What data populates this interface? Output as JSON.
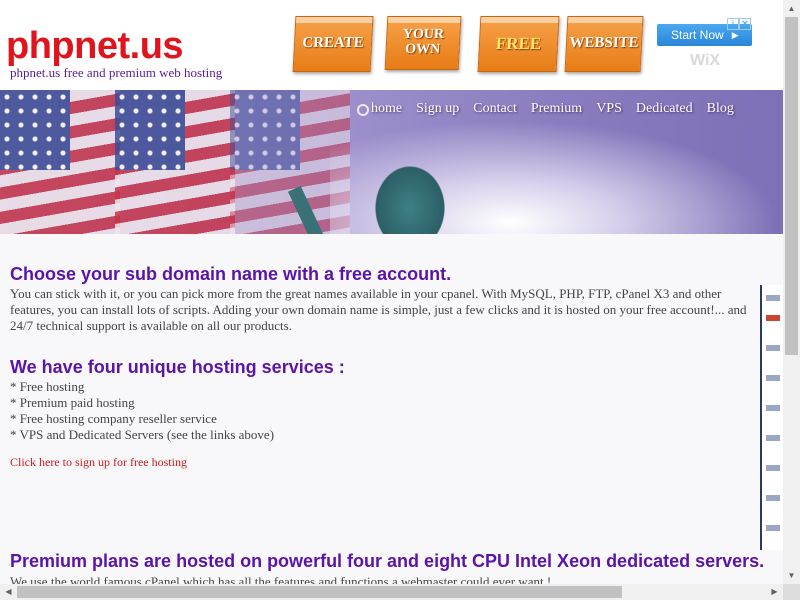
{
  "header": {
    "logo_text": "phpnet.us",
    "tagline": "phpnet.us free and premium web hosting"
  },
  "ad": {
    "tiles": [
      {
        "label": "CREATE",
        "style": "orange-white"
      },
      {
        "label": "YOUR OWN",
        "style": "orange-white"
      },
      {
        "label": "FREE",
        "style": "orange-yellow"
      },
      {
        "label": "WEBSITE",
        "style": "orange-white"
      }
    ],
    "start_button": "Start Now",
    "brand": "WiX",
    "adchoices_icons": [
      "info-icon",
      "close-icon"
    ]
  },
  "nav": {
    "items": [
      "home",
      "Sign up",
      "Contact",
      "Premium",
      "VPS",
      "Dedicated",
      "Blog"
    ]
  },
  "main": {
    "section1": {
      "heading": "Choose your sub domain name with a free account.",
      "text": "You can stick with it, or you can pick more from the great names available in your cpanel. With MySQL, PHP, FTP, cPanel X3 and other features, you can install lots of scripts. Adding your own domain name is simple, just a few clicks and it is hosted on your free account!... and 24/7 technical support is available on all our products."
    },
    "section2": {
      "heading": "We have four unique hosting services :",
      "items": [
        "* Free hosting",
        "* Premium paid hosting",
        "* Free hosting company reseller service",
        "* VPS and Dedicated Servers (see the links above)"
      ],
      "link": "Click here to sign up for free hosting"
    },
    "section3": {
      "heading": "Premium plans are hosted on powerful four and eight CPU Intel Xeon dedicated servers.",
      "text": "We use the world famous cPanel which has all the features and functions a webmaster could ever want !"
    }
  },
  "colors": {
    "logo": "#e0141c",
    "heading": "#5b14a8",
    "link": "#d01a1a",
    "ad_orange": "#e77c16",
    "banner": "#9d8fcb"
  }
}
